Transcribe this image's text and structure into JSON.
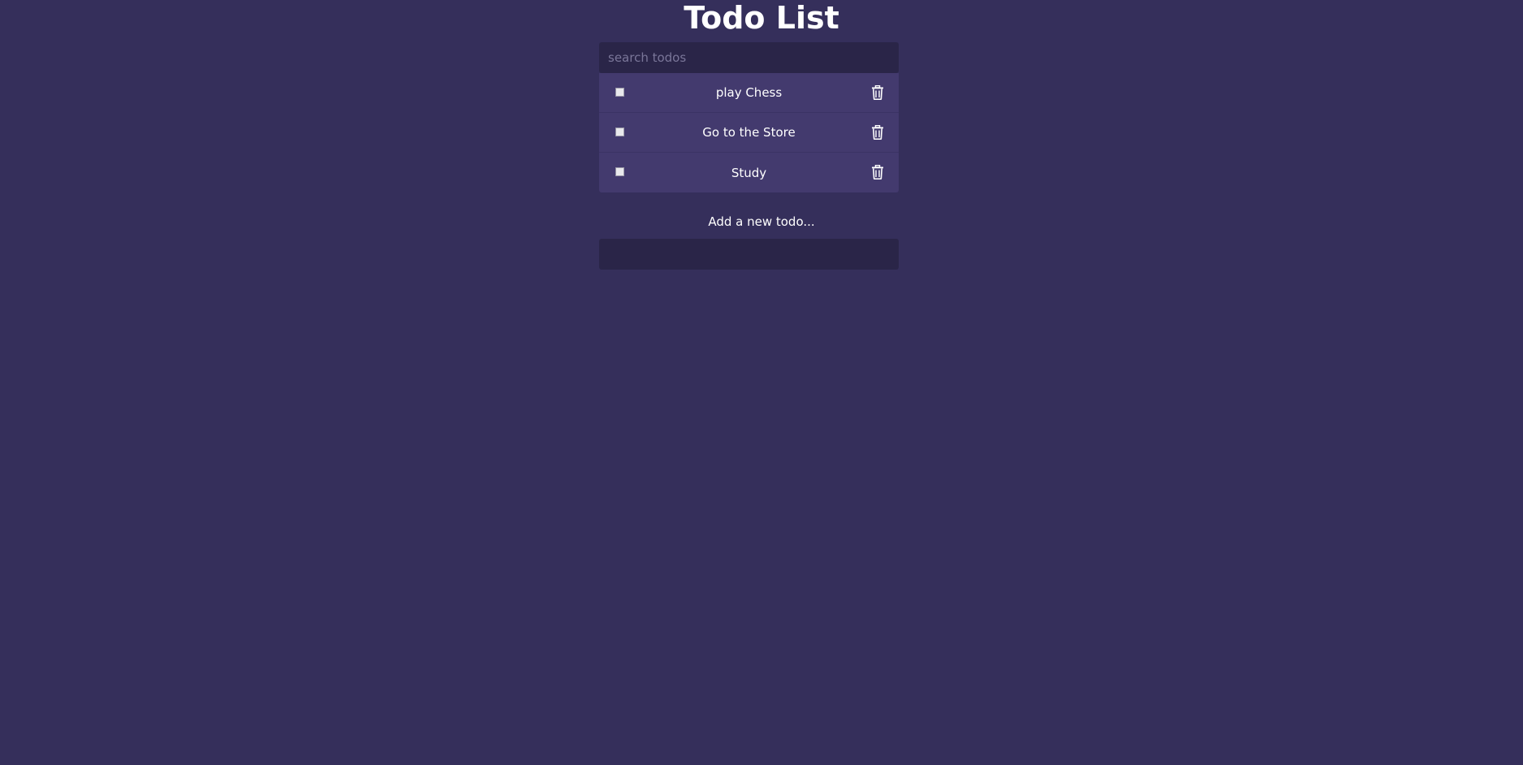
{
  "header": {
    "title": "Todo List"
  },
  "search": {
    "placeholder": "search todos",
    "value": ""
  },
  "todos": [
    {
      "label": "play Chess",
      "checked": false
    },
    {
      "label": "Go to the Store",
      "checked": false
    },
    {
      "label": "Study",
      "checked": false
    }
  ],
  "add": {
    "label": "Add a new todo...",
    "value": ""
  },
  "icons": {
    "delete": "trash-icon",
    "checkbox": "checkbox-icon"
  },
  "colors": {
    "background": "#352f5b",
    "input_background": "#2a2548",
    "list_background": "#433a6e",
    "text": "#ffffff"
  }
}
